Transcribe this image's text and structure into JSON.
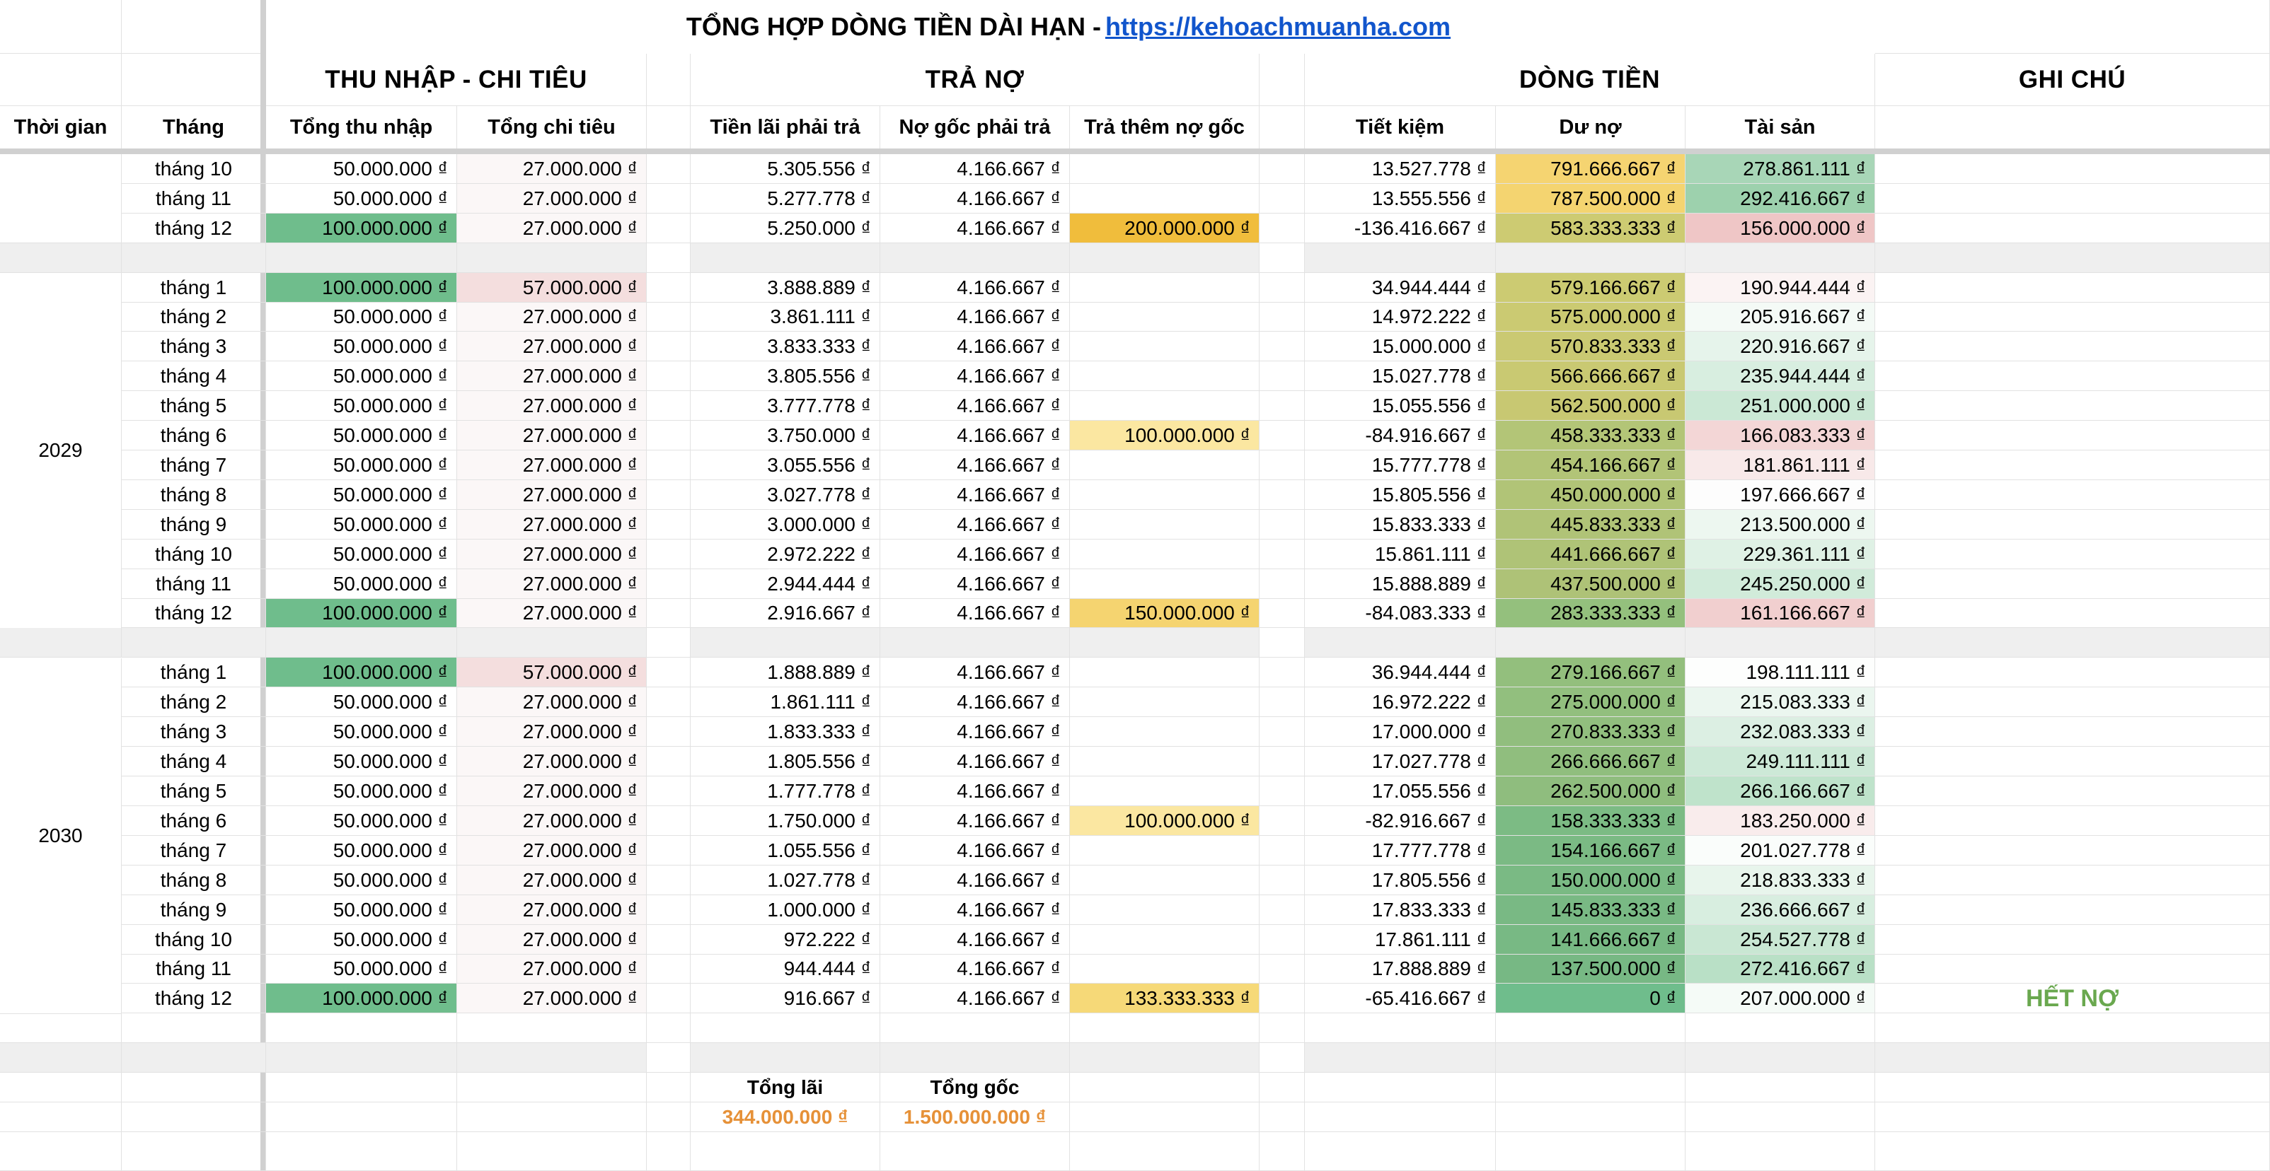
{
  "title": {
    "text": "TỔNG HỢP DÒNG TIỀN DÀI HẠN -",
    "link": "https://kehoachmuanha.com"
  },
  "groups": {
    "income": "THU NHẬP - CHI TIÊU",
    "debt": "TRẢ NỢ",
    "cashflow": "DÒNG TIỀN",
    "notes": "GHI CHÚ"
  },
  "columns": {
    "time": "Thời gian",
    "month": "Tháng",
    "income": "Tổng thu nhập",
    "expense": "Tổng chi tiêu",
    "interest": "Tiền lãi phải trả",
    "principal": "Nợ gốc phải trả",
    "extra": "Trả thêm nợ gốc",
    "savings": "Tiết kiệm",
    "debt": "Dư nợ",
    "assets": "Tài sản"
  },
  "colors": {
    "green_strong": "#6fbd8c",
    "green_mid": "#a5d6b6",
    "green_light": "#d7eedf",
    "green_pale": "#eef7f1",
    "pink_strong": "#efc6c6",
    "pink_light": "#f7e6e6",
    "pink_pale": "#fbf3f3",
    "yellow_strong": "#f0c246",
    "yellow_mid": "#f5d775",
    "yellow_light": "#fbe7a1",
    "olive": "#c6cc72",
    "sep_gray": "#efefef",
    "note_green": "#6aa84f",
    "sum_orange": "#e69138",
    "link_blue": "#1155cc"
  },
  "blocks": [
    {
      "year": "",
      "rows": [
        {
          "month": "tháng 10",
          "income": "50.000.000 ₫",
          "expense": "27.000.000 ₫",
          "interest": "5.305.556 ₫",
          "principal": "4.166.667 ₫",
          "extra": "",
          "savings": "13.527.778 ₫",
          "debt": "791.666.667 ₫",
          "assets": "278.861.111 ₫",
          "note": "",
          "bg": {
            "income": "",
            "expense": "#fbf7f7",
            "extra": "",
            "debt": "#f5d471",
            "assets": "#a8d6b7"
          }
        },
        {
          "month": "tháng 11",
          "income": "50.000.000 ₫",
          "expense": "27.000.000 ₫",
          "interest": "5.277.778 ₫",
          "principal": "4.166.667 ₫",
          "extra": "",
          "savings": "13.555.556 ₫",
          "debt": "787.500.000 ₫",
          "assets": "292.416.667 ₫",
          "note": "",
          "bg": {
            "income": "",
            "expense": "#fbf7f7",
            "extra": "",
            "debt": "#f4d470",
            "assets": "#9dd1ad"
          }
        },
        {
          "month": "tháng 12",
          "income": "100.000.000 ₫",
          "expense": "27.000.000 ₫",
          "interest": "5.250.000 ₫",
          "principal": "4.166.667 ₫",
          "extra": "200.000.000 ₫",
          "savings": "-136.416.667 ₫",
          "debt": "583.333.333 ₫",
          "assets": "156.000.000 ₫",
          "note": "",
          "bg": {
            "income": "#6fbd8c",
            "expense": "#fbf7f7",
            "extra": "#f0bd3c",
            "debt": "#cdcb72",
            "assets": "#efc6c6"
          }
        }
      ]
    },
    {
      "year": "2029",
      "rows": [
        {
          "month": "tháng 1",
          "income": "100.000.000 ₫",
          "expense": "57.000.000 ₫",
          "interest": "3.888.889 ₫",
          "principal": "4.166.667 ₫",
          "extra": "",
          "savings": "34.944.444 ₫",
          "debt": "579.166.667 ₫",
          "assets": "190.944.444 ₫",
          "note": "",
          "bg": {
            "income": "#6fbd8c",
            "expense": "#f4dede",
            "extra": "",
            "debt": "#cccb72",
            "assets": "#fbf3f3"
          }
        },
        {
          "month": "tháng 2",
          "income": "50.000.000 ₫",
          "expense": "27.000.000 ₫",
          "interest": "3.861.111 ₫",
          "principal": "4.166.667 ₫",
          "extra": "",
          "savings": "14.972.222 ₫",
          "debt": "575.000.000 ₫",
          "assets": "205.916.667 ₫",
          "note": "",
          "bg": {
            "income": "",
            "expense": "#fbf7f7",
            "extra": "",
            "debt": "#cbca72",
            "assets": "#f4faf6"
          }
        },
        {
          "month": "tháng 3",
          "income": "50.000.000 ₫",
          "expense": "27.000.000 ₫",
          "interest": "3.833.333 ₫",
          "principal": "4.166.667 ₫",
          "extra": "",
          "savings": "15.000.000 ₫",
          "debt": "570.833.333 ₫",
          "assets": "220.916.667 ₫",
          "note": "",
          "bg": {
            "income": "",
            "expense": "#fbf7f7",
            "extra": "",
            "debt": "#cac972",
            "assets": "#e6f4eb"
          }
        },
        {
          "month": "tháng 4",
          "income": "50.000.000 ₫",
          "expense": "27.000.000 ₫",
          "interest": "3.805.556 ₫",
          "principal": "4.166.667 ₫",
          "extra": "",
          "savings": "15.027.778 ₫",
          "debt": "566.666.667 ₫",
          "assets": "235.944.444 ₫",
          "note": "",
          "bg": {
            "income": "",
            "expense": "#fbf7f7",
            "extra": "",
            "debt": "#c9c972",
            "assets": "#d8eee0"
          }
        },
        {
          "month": "tháng 5",
          "income": "50.000.000 ₫",
          "expense": "27.000.000 ₫",
          "interest": "3.777.778 ₫",
          "principal": "4.166.667 ₫",
          "extra": "",
          "savings": "15.055.556 ₫",
          "debt": "562.500.000 ₫",
          "assets": "251.000.000 ₫",
          "note": "",
          "bg": {
            "income": "",
            "expense": "#fbf7f7",
            "extra": "",
            "debt": "#c8c872",
            "assets": "#cbe8d5"
          }
        },
        {
          "month": "tháng 6",
          "income": "50.000.000 ₫",
          "expense": "27.000.000 ₫",
          "interest": "3.750.000 ₫",
          "principal": "4.166.667 ₫",
          "extra": "100.000.000 ₫",
          "savings": "-84.916.667 ₫",
          "debt": "458.333.333 ₫",
          "assets": "166.083.333 ₫",
          "note": "",
          "bg": {
            "income": "",
            "expense": "#fbf7f7",
            "extra": "#fbe7a1",
            "debt": "#b3c577",
            "assets": "#f3d6d6"
          }
        },
        {
          "month": "tháng 7",
          "income": "50.000.000 ₫",
          "expense": "27.000.000 ₫",
          "interest": "3.055.556 ₫",
          "principal": "4.166.667 ₫",
          "extra": "",
          "savings": "15.777.778 ₫",
          "debt": "454.166.667 ₫",
          "assets": "181.861.111 ₫",
          "note": "",
          "bg": {
            "income": "",
            "expense": "#fbf7f7",
            "extra": "",
            "debt": "#b2c477",
            "assets": "#f8e9e9"
          }
        },
        {
          "month": "tháng 8",
          "income": "50.000.000 ₫",
          "expense": "27.000.000 ₫",
          "interest": "3.027.778 ₫",
          "principal": "4.166.667 ₫",
          "extra": "",
          "savings": "15.805.556 ₫",
          "debt": "450.000.000 ₫",
          "assets": "197.666.667 ₫",
          "note": "",
          "bg": {
            "income": "",
            "expense": "#fbf7f7",
            "extra": "",
            "debt": "#b1c477",
            "assets": "#fdfdfd"
          }
        },
        {
          "month": "tháng 9",
          "income": "50.000.000 ₫",
          "expense": "27.000.000 ₫",
          "interest": "3.000.000 ₫",
          "principal": "4.166.667 ₫",
          "extra": "",
          "savings": "15.833.333 ₫",
          "debt": "445.833.333 ₫",
          "assets": "213.500.000 ₫",
          "note": "",
          "bg": {
            "income": "",
            "expense": "#fbf7f7",
            "extra": "",
            "debt": "#b0c377",
            "assets": "#edf7f0"
          }
        },
        {
          "month": "tháng 10",
          "income": "50.000.000 ₫",
          "expense": "27.000.000 ₫",
          "interest": "2.972.222 ₫",
          "principal": "4.166.667 ₫",
          "extra": "",
          "savings": "15.861.111 ₫",
          "debt": "441.666.667 ₫",
          "assets": "229.361.111 ₫",
          "note": "",
          "bg": {
            "income": "",
            "expense": "#fbf7f7",
            "extra": "",
            "debt": "#afc377",
            "assets": "#dff1e5"
          }
        },
        {
          "month": "tháng 11",
          "income": "50.000.000 ₫",
          "expense": "27.000.000 ₫",
          "interest": "2.944.444 ₫",
          "principal": "4.166.667 ₫",
          "extra": "",
          "savings": "15.888.889 ₫",
          "debt": "437.500.000 ₫",
          "assets": "245.250.000 ₫",
          "note": "",
          "bg": {
            "income": "",
            "expense": "#fbf7f7",
            "extra": "",
            "debt": "#aec277",
            "assets": "#d1ebda"
          }
        },
        {
          "month": "tháng 12",
          "income": "100.000.000 ₫",
          "expense": "27.000.000 ₫",
          "interest": "2.916.667 ₫",
          "principal": "4.166.667 ₫",
          "extra": "150.000.000 ₫",
          "savings": "-84.083.333 ₫",
          "debt": "283.333.333 ₫",
          "assets": "161.166.667 ₫",
          "note": "",
          "bg": {
            "income": "#6fbd8c",
            "expense": "#fbf7f7",
            "extra": "#f5d470",
            "debt": "#94c07d",
            "assets": "#f1cfcf"
          }
        }
      ]
    },
    {
      "year": "2030",
      "rows": [
        {
          "month": "tháng 1",
          "income": "100.000.000 ₫",
          "expense": "57.000.000 ₫",
          "interest": "1.888.889 ₫",
          "principal": "4.166.667 ₫",
          "extra": "",
          "savings": "36.944.444 ₫",
          "debt": "279.166.667 ₫",
          "assets": "198.111.111 ₫",
          "note": "",
          "bg": {
            "income": "#6fbd8c",
            "expense": "#f4dede",
            "extra": "",
            "debt": "#93bf7d",
            "assets": "#fdfefd"
          }
        },
        {
          "month": "tháng 2",
          "income": "50.000.000 ₫",
          "expense": "27.000.000 ₫",
          "interest": "1.861.111 ₫",
          "principal": "4.166.667 ₫",
          "extra": "",
          "savings": "16.972.222 ₫",
          "debt": "275.000.000 ₫",
          "assets": "215.083.333 ₫",
          "note": "",
          "bg": {
            "income": "",
            "expense": "#fbf7f7",
            "extra": "",
            "debt": "#92bf7e",
            "assets": "#ebf6ef"
          }
        },
        {
          "month": "tháng 3",
          "income": "50.000.000 ₫",
          "expense": "27.000.000 ₫",
          "interest": "1.833.333 ₫",
          "principal": "4.166.667 ₫",
          "extra": "",
          "savings": "17.000.000 ₫",
          "debt": "270.833.333 ₫",
          "assets": "232.083.333 ₫",
          "note": "",
          "bg": {
            "income": "",
            "expense": "#fbf7f7",
            "extra": "",
            "debt": "#91be7e",
            "assets": "#dcefe3"
          }
        },
        {
          "month": "tháng 4",
          "income": "50.000.000 ₫",
          "expense": "27.000.000 ₫",
          "interest": "1.805.556 ₫",
          "principal": "4.166.667 ₫",
          "extra": "",
          "savings": "17.027.778 ₫",
          "debt": "266.666.667 ₫",
          "assets": "249.111.111 ₫",
          "note": "",
          "bg": {
            "income": "",
            "expense": "#fbf7f7",
            "extra": "",
            "debt": "#90be7e",
            "assets": "#cde9d7"
          }
        },
        {
          "month": "tháng 5",
          "income": "50.000.000 ₫",
          "expense": "27.000.000 ₫",
          "interest": "1.777.778 ₫",
          "principal": "4.166.667 ₫",
          "extra": "",
          "savings": "17.055.556 ₫",
          "debt": "262.500.000 ₫",
          "assets": "266.166.667 ₫",
          "note": "",
          "bg": {
            "income": "",
            "expense": "#fbf7f7",
            "extra": "",
            "debt": "#8fbd7e",
            "assets": "#bfe3cb"
          }
        },
        {
          "month": "tháng 6",
          "income": "50.000.000 ₫",
          "expense": "27.000.000 ₫",
          "interest": "1.750.000 ₫",
          "principal": "4.166.667 ₫",
          "extra": "100.000.000 ₫",
          "savings": "-82.916.667 ₫",
          "debt": "158.333.333 ₫",
          "assets": "183.250.000 ₫",
          "note": "",
          "bg": {
            "income": "",
            "expense": "#fbf7f7",
            "extra": "#fbe7a1",
            "debt": "#7cbb84",
            "assets": "#f9ecec"
          }
        },
        {
          "month": "tháng 7",
          "income": "50.000.000 ₫",
          "expense": "27.000.000 ₫",
          "interest": "1.055.556 ₫",
          "principal": "4.166.667 ₫",
          "extra": "",
          "savings": "17.777.778 ₫",
          "debt": "154.166.667 ₫",
          "assets": "201.027.778 ₫",
          "note": "",
          "bg": {
            "income": "",
            "expense": "#fbf7f7",
            "extra": "",
            "debt": "#7bba84",
            "assets": "#fafdfb"
          }
        },
        {
          "month": "tháng 8",
          "income": "50.000.000 ₫",
          "expense": "27.000.000 ₫",
          "interest": "1.027.778 ₫",
          "principal": "4.166.667 ₫",
          "extra": "",
          "savings": "17.805.556 ₫",
          "debt": "150.000.000 ₫",
          "assets": "218.833.333 ₫",
          "note": "",
          "bg": {
            "income": "",
            "expense": "#fbf7f7",
            "extra": "",
            "debt": "#7aba84",
            "assets": "#e8f5ec"
          }
        },
        {
          "month": "tháng 9",
          "income": "50.000.000 ₫",
          "expense": "27.000.000 ₫",
          "interest": "1.000.000 ₫",
          "principal": "4.166.667 ₫",
          "extra": "",
          "savings": "17.833.333 ₫",
          "debt": "145.833.333 ₫",
          "assets": "236.666.667 ₫",
          "note": "",
          "bg": {
            "income": "",
            "expense": "#fbf7f7",
            "extra": "",
            "debt": "#79b984",
            "assets": "#d8eee0"
          }
        },
        {
          "month": "tháng 10",
          "income": "50.000.000 ₫",
          "expense": "27.000.000 ₫",
          "interest": "972.222 ₫",
          "principal": "4.166.667 ₫",
          "extra": "",
          "savings": "17.861.111 ₫",
          "debt": "141.666.667 ₫",
          "assets": "254.527.778 ₫",
          "note": "",
          "bg": {
            "income": "",
            "expense": "#fbf7f7",
            "extra": "",
            "debt": "#78b984",
            "assets": "#c9e7d3"
          }
        },
        {
          "month": "tháng 11",
          "income": "50.000.000 ₫",
          "expense": "27.000.000 ₫",
          "interest": "944.444 ₫",
          "principal": "4.166.667 ₫",
          "extra": "",
          "savings": "17.888.889 ₫",
          "debt": "137.500.000 ₫",
          "assets": "272.416.667 ₫",
          "note": "",
          "bg": {
            "income": "",
            "expense": "#fbf7f7",
            "extra": "",
            "debt": "#77b884",
            "assets": "#b9e0c6"
          }
        },
        {
          "month": "tháng 12",
          "income": "100.000.000 ₫",
          "expense": "27.000.000 ₫",
          "interest": "916.667 ₫",
          "principal": "4.166.667 ₫",
          "extra": "133.333.333 ₫",
          "savings": "-65.416.667 ₫",
          "debt": "0 ₫",
          "assets": "207.000.000 ₫",
          "note": "HẾT NỢ",
          "bg": {
            "income": "#6fbd8c",
            "expense": "#fbf7f7",
            "extra": "#f6d978",
            "debt": "#6fbd8c",
            "assets": "#f5fbf7"
          }
        }
      ]
    }
  ],
  "summary": {
    "interest_label": "Tổng lãi",
    "principal_label": "Tổng gốc",
    "interest_value": "344.000.000 ₫",
    "principal_value": "1.500.000.000 ₫"
  }
}
